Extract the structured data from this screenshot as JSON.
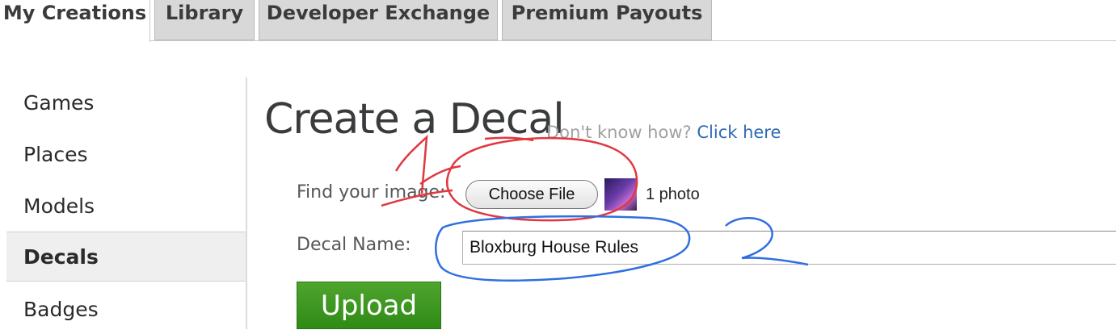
{
  "tabs": [
    {
      "label": "My Creations",
      "active": true
    },
    {
      "label": "Library",
      "active": false
    },
    {
      "label": "Developer Exchange",
      "active": false
    },
    {
      "label": "Premium Payouts",
      "active": false
    }
  ],
  "sidebar": {
    "items": [
      {
        "label": "Games",
        "active": false
      },
      {
        "label": "Places",
        "active": false
      },
      {
        "label": "Models",
        "active": false
      },
      {
        "label": "Decals",
        "active": true
      },
      {
        "label": "Badges",
        "active": false
      }
    ]
  },
  "main": {
    "title": "Create a Decal",
    "help_prefix": "Don't know how?",
    "help_link": "Click here",
    "find_label": "Find your image:",
    "choose_file_label": "Choose File",
    "file_status": "1 photo",
    "name_label": "Decal Name:",
    "name_value": "Bloxburg House Rules",
    "upload_label": "Upload"
  },
  "colors": {
    "upload_green": "#3b9a1f",
    "link_blue": "#2d6bb3",
    "annotation_red": "#e0383f",
    "annotation_blue": "#2f6fe0"
  },
  "annotations": [
    {
      "mark": "1",
      "color": "red",
      "target": "choose-file"
    },
    {
      "mark": "2",
      "color": "blue",
      "target": "decal-name"
    }
  ]
}
